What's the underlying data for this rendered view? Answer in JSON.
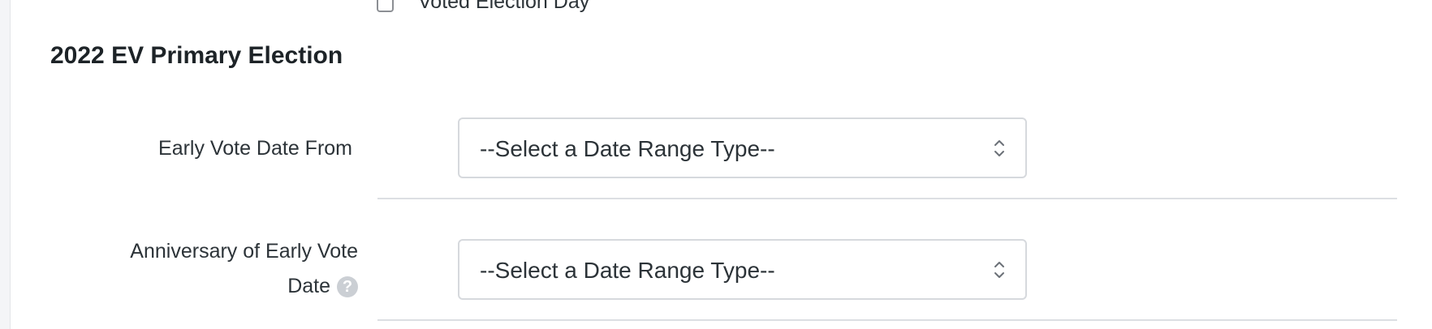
{
  "top_checkbox": {
    "label": "Voted Election Day",
    "checked": false
  },
  "section": {
    "title": "2022 EV Primary Election"
  },
  "fields": [
    {
      "label": "Early Vote Date From",
      "select_value": "--Select a Date Range Type--"
    },
    {
      "label_line1": "Anniversary of Early Vote",
      "label_line2": "Date",
      "help_icon": "question-icon",
      "select_value": "--Select a Date Range Type--"
    }
  ],
  "colors": {
    "text": "#2c3338",
    "border": "#d6d9dd",
    "divider": "#dcdfe3",
    "help_icon_bg": "#cbcfd4"
  }
}
